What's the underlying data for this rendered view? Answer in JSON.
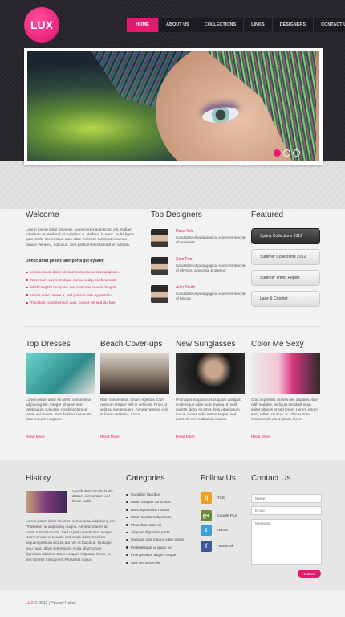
{
  "logo": "LUX",
  "nav": [
    {
      "label": "Home",
      "active": true
    },
    {
      "label": "About us"
    },
    {
      "label": "Collections"
    },
    {
      "label": "Links"
    },
    {
      "label": "Designers"
    },
    {
      "label": "Contact us"
    }
  ],
  "slider": {
    "dots": 3,
    "active": 0
  },
  "welcome": {
    "title": "Welcome",
    "body": "Lorem ipsum dolor sit amet, consectetur adipiscing elit. Nullam interdum et, eleifend ut curabitur a, eleifend in nunc. Nulla ligula quis Morbi scelerisque quis vitae molestie turpis ut vivamus ornare vel arcu, ridiculus. Sed pretium felis blandit en adriam.",
    "subtitle": "Donec amet pellen: aler porta qui oyseet:",
    "bullets": [
      "Lorem ipsum dolor sit amet consectetur cras adipiscin.",
      "Nunc nam vivere tristique cursus a dig, eleifend sust.",
      "Morbi sagittis dui quam nec erat vitae mauris feugiat.",
      "Varius nunc ornare a, sed pretium felis egestemin.",
      "Tincidunt condimentum dapi, cursus vel sed dui bue."
    ]
  },
  "designers": {
    "title": "Top Designers",
    "items": [
      {
        "name": "Dana Cris",
        "desc": "Candidate of pedagogical sciences teacher of materials."
      },
      {
        "name": "Sam Pool",
        "desc": "Candidate of pedagogical sciences teacher of physics, associate professor."
      },
      {
        "name": "Alan Smith",
        "desc": "Candidate of pedagogical sciences teacher of history."
      }
    ]
  },
  "featured": {
    "title": "Featured",
    "items": [
      {
        "label": "Spring Collections 2012",
        "active": true
      },
      {
        "label": "Summer Collections 2012"
      },
      {
        "label": "Summer Trend Report"
      },
      {
        "label": "Lace & Crochet"
      }
    ]
  },
  "products": [
    {
      "title": "Top Dresses",
      "desc": "Lorem ipsum dolor sit amet, consectetur adipiscing elit. Integer sit amet sem. Vestibulum vulputate condimentum ut lorem vel viverra. Sed dapibus venenatis vitae mauris eu ipsum.",
      "read": "Read More",
      "color": "#5ec7c0"
    },
    {
      "title": "Beach Cover-ups",
      "desc": "Nam consectetur, ornare egestas. Cum nostrum tempor velit in vehicula. Proin ut velit eu non posuere. Aenean tempor eros et lorem vel tellus, luctus.",
      "read": "Read More",
      "color": "#c9c2bb"
    },
    {
      "title": "New Sunglasses",
      "desc": "Proin quis magna cursus quam volutpat scelerisque vitae nunc massa. In velit sagittis, dolor sit amet, felis vitae ipsum luctus, luctus nulla metus neque, sed amet elit vel vestibulum mauris.",
      "read": "Read More",
      "color": "#3a3a3a"
    },
    {
      "title": "Color Me Sexy",
      "desc": "Cras imperdiet, massa nec dapibus vitae nibh sodales, ac ligula tincidunt vitae, egitet ultrices et sed lorem. Lorem ipsum sem, tellus volutpat, ac ultrices dolor. Vivamus elit amet ipsum, lorem.",
      "read": "Read More",
      "color": "#d64a8a"
    }
  ],
  "history": {
    "title": "History",
    "quote": "Vestibulum iaculis la dis dictum elementum vel fusce nulla.",
    "body": "Lorem ipsum dolor sit amet, consectetur adipiscing elit. Phasellus ne adipiscing magna. Aenean mauris ac lorem rutrum lobortis. Sed ut justo vestibulum tempus. Nam Aenean venenatis commodo dolor, Facilisis aliquam pretium dictum dui nec ut faucibus. Quisque arcu nunc, diam sed mauris. Nulla ullamcorper dignissim ultricies. Donec aliquet vulputate lorem, ut sed lobortis tristique et. Phasellus augue."
  },
  "categories": {
    "title": "Categories",
    "items": [
      "Curabitur faucibus",
      "Etiam congue commodo",
      "Nunc eget tellus massa",
      "Etiam tincidunt dignissim",
      "Phasellus tortor mi",
      "Aliquam dignissim porta",
      "Quisque quis magna vitae purus",
      "Pellentesque ut quam vel",
      "Proin pretium aliquet neque",
      "Sed nec lacus elit"
    ]
  },
  "follow": {
    "title": "Follow Us",
    "items": [
      {
        "label": "RSS",
        "icon": "rss-icon",
        "glyph": "))",
        "color": "#f0a020"
      },
      {
        "label": "Google Plus",
        "icon": "google-plus-icon",
        "glyph": "g+",
        "color": "#6a8a3a"
      },
      {
        "label": "Twitter",
        "icon": "twitter-icon",
        "glyph": "t",
        "color": "#3aa0d8"
      },
      {
        "label": "Facebook",
        "icon": "facebook-icon",
        "glyph": "f",
        "color": "#3b5998"
      }
    ]
  },
  "contact": {
    "title": "Contact Us",
    "name_placeholder": "Name:",
    "email_placeholder": "Email:",
    "message_placeholder": "Message:",
    "submit": "Submit"
  },
  "footer": {
    "brand": "LUX",
    "rest": " © 2012  |  Privacy Policy"
  }
}
